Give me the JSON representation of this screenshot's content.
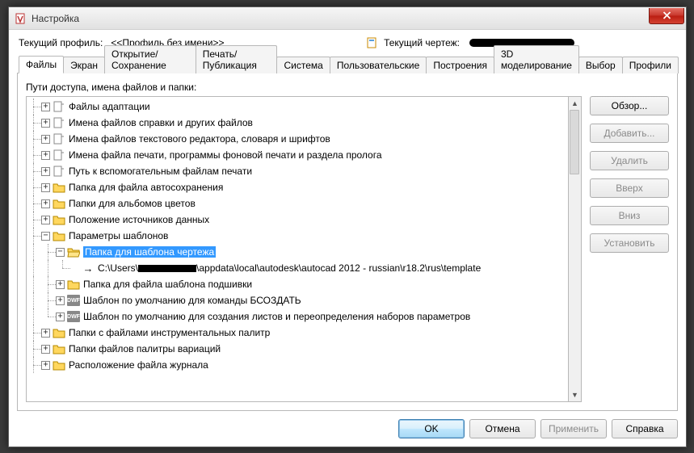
{
  "window": {
    "title": "Настройка"
  },
  "profile": {
    "label": "Текущий профиль:",
    "value": "<<Профиль без имени>>",
    "drawing_label": "Текущий чертеж:"
  },
  "tabs": [
    {
      "label": "Файлы",
      "active": true
    },
    {
      "label": "Экран"
    },
    {
      "label": "Открытие/Сохранение"
    },
    {
      "label": "Печать/Публикация"
    },
    {
      "label": "Система"
    },
    {
      "label": "Пользовательские"
    },
    {
      "label": "Построения"
    },
    {
      "label": "3D моделирование"
    },
    {
      "label": "Выбор"
    },
    {
      "label": "Профили"
    }
  ],
  "section_label": "Пути доступа, имена файлов и папки:",
  "side_buttons": {
    "browse": {
      "label": "Обзор...",
      "enabled": true
    },
    "add": {
      "label": "Добавить...",
      "enabled": false
    },
    "delete": {
      "label": "Удалить",
      "enabled": false
    },
    "up": {
      "label": "Вверх",
      "enabled": false
    },
    "down": {
      "label": "Вниз",
      "enabled": false
    },
    "set": {
      "label": "Установить",
      "enabled": false
    }
  },
  "bottom": {
    "ok": "OK",
    "cancel": "Отмена",
    "apply": "Применить",
    "help": "Справка"
  },
  "tree": [
    {
      "depth": 0,
      "exp": "+",
      "icon": "doc",
      "label": "Файлы адаптации"
    },
    {
      "depth": 0,
      "exp": "+",
      "icon": "doc",
      "label": "Имена файлов справки и других файлов"
    },
    {
      "depth": 0,
      "exp": "+",
      "icon": "doc",
      "label": "Имена файлов текстового редактора, словаря и шрифтов"
    },
    {
      "depth": 0,
      "exp": "+",
      "icon": "doc",
      "label": "Имена файла печати, программы фоновой печати и раздела пролога"
    },
    {
      "depth": 0,
      "exp": "+",
      "icon": "doc",
      "label": "Путь к вспомогательным файлам печати"
    },
    {
      "depth": 0,
      "exp": "+",
      "icon": "folder",
      "label": "Папка для файла автосохранения"
    },
    {
      "depth": 0,
      "exp": "+",
      "icon": "folder",
      "label": "Папки для альбомов цветов"
    },
    {
      "depth": 0,
      "exp": "+",
      "icon": "folder",
      "label": "Положение источников данных"
    },
    {
      "depth": 0,
      "exp": "-",
      "icon": "folder",
      "label": "Параметры шаблонов"
    },
    {
      "depth": 1,
      "exp": "-",
      "icon": "folder-open",
      "label": "Папка для шаблона чертежа",
      "selected": true
    },
    {
      "depth": 2,
      "exp": "",
      "icon": "arrow",
      "path_pre": "C:\\Users\\",
      "path_post": "\\appdata\\local\\autodesk\\autocad 2012 - russian\\r18.2\\rus\\template",
      "last": true
    },
    {
      "depth": 1,
      "exp": "+",
      "icon": "folder",
      "label": "Папка для файла шаблона подшивки"
    },
    {
      "depth": 1,
      "exp": "+",
      "icon": "dwg",
      "label": "Шаблон по умолчанию для команды БСОЗДАТЬ"
    },
    {
      "depth": 1,
      "exp": "+",
      "icon": "dwg",
      "label": "Шаблон по умолчанию для создания листов и переопределения наборов параметров",
      "last": true
    },
    {
      "depth": 0,
      "exp": "+",
      "icon": "folder",
      "label": "Папки с файлами инструментальных палитр"
    },
    {
      "depth": 0,
      "exp": "+",
      "icon": "folder",
      "label": "Папки файлов палитры вариаций"
    },
    {
      "depth": 0,
      "exp": "+",
      "icon": "folder",
      "label": "Расположение файла журнала"
    }
  ]
}
